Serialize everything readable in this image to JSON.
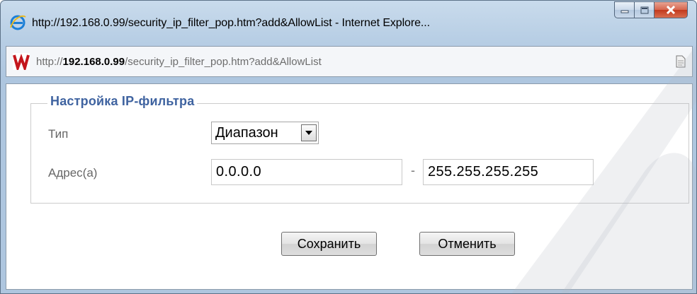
{
  "window": {
    "title": "http://192.168.0.99/security_ip_filter_pop.htm?add&AllowList - Internet Explore...",
    "icon": "ie-icon",
    "controls": [
      "minimize-icon",
      "maximize-icon",
      "close-icon"
    ]
  },
  "address_bar": {
    "url_prefix": "http://",
    "url_host": "192.168.0.99",
    "url_path": "/security_ip_filter_pop.htm?add&AllowList"
  },
  "form": {
    "legend": "Настройка IP-фильтра",
    "type_label": "Тип",
    "type_value": "Диапазон",
    "address_label": "Адрес(а)",
    "ip_start": "0.0.0.0",
    "range_separator": "-",
    "ip_end": "255.255.255.255"
  },
  "buttons": {
    "save": "Сохранить",
    "cancel": "Отменить"
  },
  "colors": {
    "legend": "#3f63a0",
    "close_button": "#c2391c",
    "frame": "#b6cde4"
  }
}
